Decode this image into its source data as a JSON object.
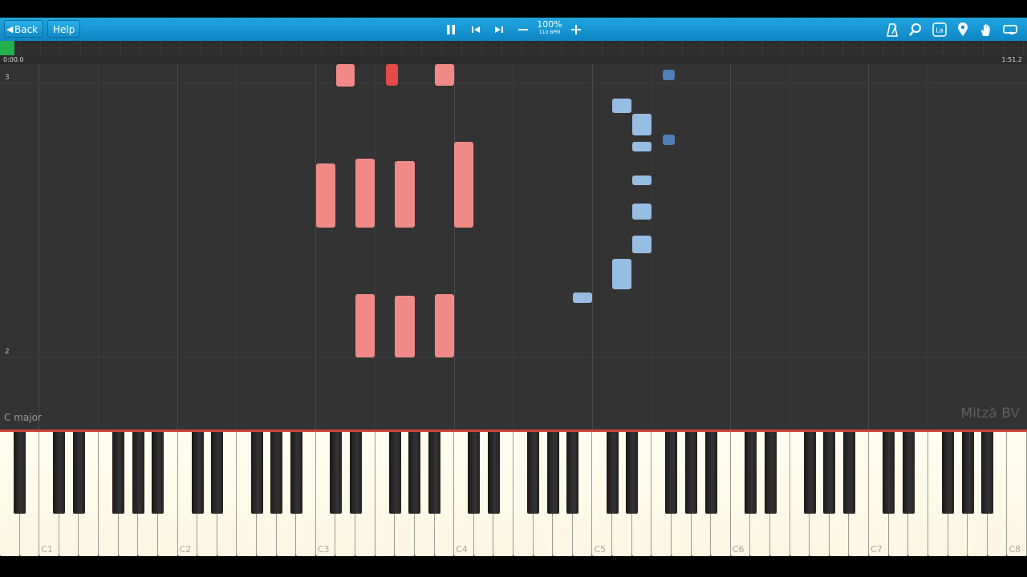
{
  "toolbar": {
    "back_label": "Back",
    "help_label": "Help",
    "zoom_percent": "100%",
    "tempo": "110 BPM"
  },
  "timeline": {
    "current_time": "0:00.0",
    "total_time": "1:51.2"
  },
  "roll": {
    "measure_top": "3",
    "measure_bottom": "2",
    "key_signature": "C major",
    "watermark": "Mitză BV"
  },
  "keyboard": {
    "octave_labels": [
      "C1",
      "C2",
      "C3",
      "C4",
      "C5",
      "C6",
      "C7",
      "C8"
    ]
  },
  "colors": {
    "toolbar": "#1a9ad8",
    "right_hand_note": "#f08a87",
    "left_hand_note": "#98bde3",
    "progress": "#22b14c"
  }
}
